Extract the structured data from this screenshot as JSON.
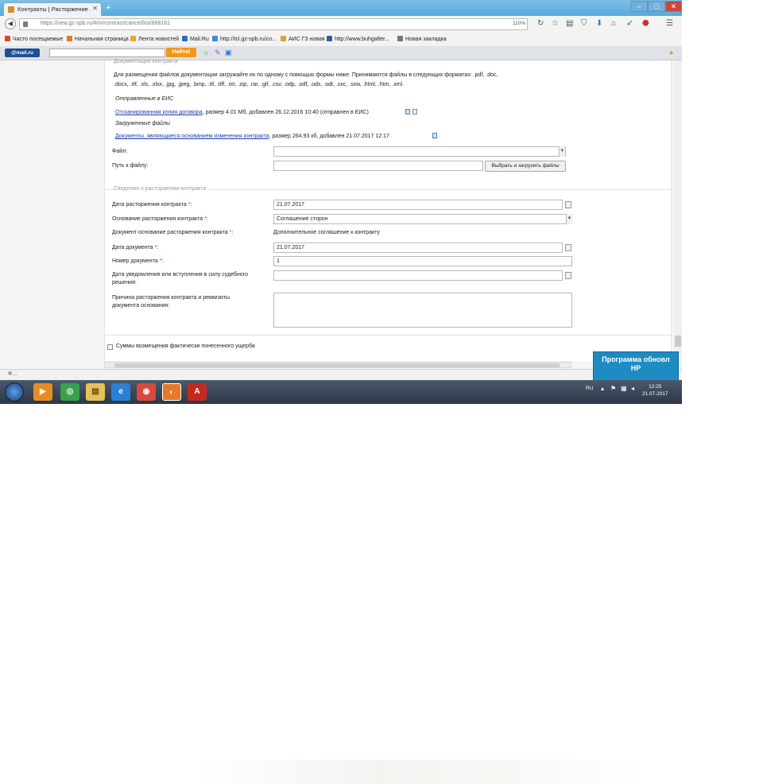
{
  "browser": {
    "tab_title": "Контракты | Расторжение ...",
    "new_tab_label": "+",
    "url": "https://new.gz-spb.ru/#/m/contract/cancel/list/868161",
    "zoom": "110%",
    "window_controls": {
      "minimize": "–",
      "maximize": "□",
      "close": "✕"
    }
  },
  "bookmarks": [
    {
      "label": "Часто посещаемые",
      "color": "#d34a2f"
    },
    {
      "label": "Начальная страница",
      "color": "#e07a20"
    },
    {
      "label": "Лента новостей",
      "color": "#f0a23a"
    },
    {
      "label": "Mail.Ru",
      "color": "#2a6fbe"
    },
    {
      "label": "http://tcl.gz-spb.ru/co...",
      "color": "#3a8bd4"
    },
    {
      "label": "АИС ГЗ новая",
      "color": "#d9a03a"
    },
    {
      "label": "http://www.buhgalter...",
      "color": "#2d5ea3"
    },
    {
      "label": "Новая закладка",
      "color": "#777777"
    }
  ],
  "addon_bar": {
    "mail_label": "@mail.ru",
    "search_placeholder": "",
    "find_button": "Найти!"
  },
  "docs_section": {
    "legend": "Документация контракта",
    "instructions": "Для размещения файлов документации загружайте их по одному с помощью формы ниже. Принимаются файлы в следующих форматах: .pdf, .doc,",
    "instructions_2": ".docx, .rtf, .xls, .xlsx, .jpg, .jpeg, .bmp, .tif, .tiff, .txt, .zip, .rar, .gif, .csv, .odp, .odf, .ods, .odt, .sxc, .sxw, .html, .htm, .xml.",
    "sent_heading": "Отправленные в ЕИС",
    "sent_link": "Отсканированная копия договора",
    "sent_meta": ", размер 4.01 Мб, добавлен 26.12.2016 10:40 (отправлен в ЕИС)",
    "uploaded_heading": "Загруженные файлы",
    "uploaded_link": "Документы, являющиеся основанием изменения контракта",
    "uploaded_meta": ", размер 264.93 кб, добавлен 21.07.2017 12:17",
    "file_label": "Файл:",
    "path_label": "Путь к файлу:",
    "upload_button": "Выбрать и загрузить файлы",
    "file_value": "",
    "path_value": ""
  },
  "termination_section": {
    "legend": "Сведения о расторжении контракта",
    "fields": {
      "termination_date": {
        "label": "Дата расторжения контракта",
        "value": "21.07.2017"
      },
      "termination_basis": {
        "label": "Основание расторжения контракта",
        "value": "Соглашение сторон"
      },
      "basis_document": {
        "label": "Документ основание расторжения контракта",
        "value": "Дополнительное соглашение к контракту"
      },
      "document_date": {
        "label": "Дата документа",
        "value": "21.07.2017"
      },
      "document_number": {
        "label": "Номер документа",
        "value": "1"
      },
      "notice_date": {
        "label": "Дата уведомления или вступления в силу судебного",
        "label_2": "решения:",
        "value": ""
      },
      "reason": {
        "label": "Причина расторжения контракта и реквизиты",
        "label_2": "документа основания:",
        "value": ""
      }
    },
    "required_mark": "*",
    "damages_checkbox": "Суммы возмещения фактически понесенного ущерба"
  },
  "status_text": "Ф...",
  "popup": {
    "line1": "Программа обновл",
    "line2": "HP"
  },
  "taskbar": {
    "apps": [
      {
        "label": "",
        "color": "#e98b24",
        "glyph": "▶"
      },
      {
        "label": "",
        "color": "#3aa04a",
        "glyph": "◎"
      },
      {
        "label": "",
        "color": "#e5c35a",
        "glyph": "▤"
      },
      {
        "label": "",
        "color": "#2c7fd6",
        "glyph": "e"
      },
      {
        "label": "",
        "color": "#d84a3a",
        "glyph": "◉"
      },
      {
        "label": "",
        "color": "#e8782a",
        "glyph": "◐"
      },
      {
        "label": "",
        "color": "#c22a1e",
        "glyph": "A"
      }
    ],
    "lang": "RU",
    "time": "12:25",
    "date": "21.07.2017"
  }
}
